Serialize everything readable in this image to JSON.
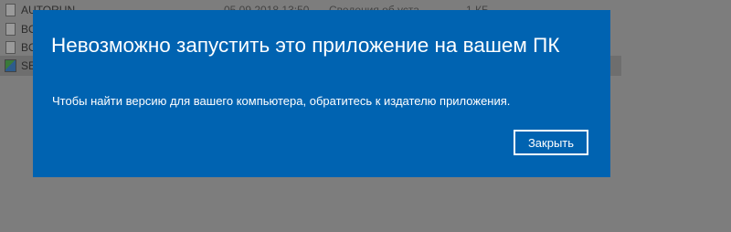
{
  "explorer": {
    "rows": [
      {
        "name": "AUTORUN",
        "date": "05.09.2018 13:50",
        "type": "Сведения об уста...",
        "size": "1 КБ"
      },
      {
        "name": "BO",
        "date": "",
        "type": "",
        "size": ""
      },
      {
        "name": "BO",
        "date": "",
        "type": "",
        "size": ""
      },
      {
        "name": "SET",
        "date": "",
        "type": "",
        "size": ""
      }
    ]
  },
  "dialog": {
    "title": "Невозможно запустить это приложение на вашем ПК",
    "message": "Чтобы найти версию для вашего компьютера, обратитесь к издателю приложения.",
    "close_label": "Закрыть",
    "background_color": "#0063b1"
  }
}
